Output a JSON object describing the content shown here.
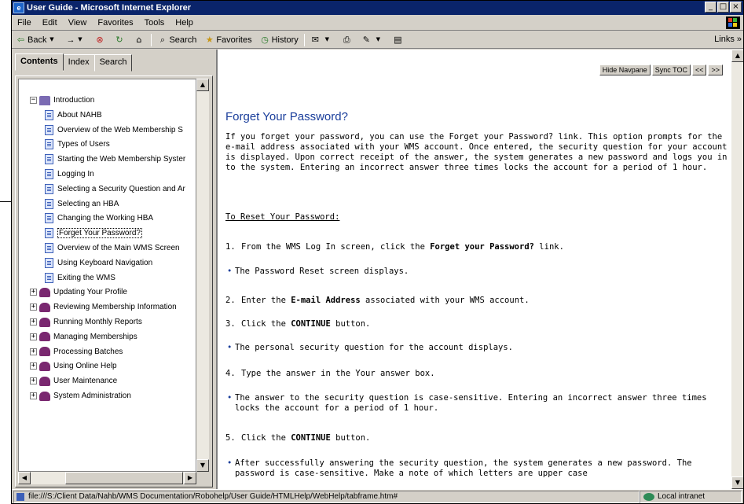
{
  "window": {
    "title": "User Guide - Microsoft Internet Explorer"
  },
  "menubar": {
    "items": [
      "File",
      "Edit",
      "View",
      "Favorites",
      "Tools",
      "Help"
    ]
  },
  "toolbar": {
    "back": "Back",
    "forward_arrow": "→",
    "search": "Search",
    "favorites": "Favorites",
    "history": "History",
    "links": "Links »"
  },
  "leftpane": {
    "tabs": [
      "Contents",
      "Index",
      "Search"
    ],
    "tree": [
      {
        "label": "Introduction",
        "type": "book-open",
        "expander": "−"
      },
      {
        "label": "About NAHB",
        "type": "page"
      },
      {
        "label": "Overview of the Web Membership S",
        "type": "page"
      },
      {
        "label": "Types of Users",
        "type": "page"
      },
      {
        "label": "Starting the Web Membership Syster",
        "type": "page"
      },
      {
        "label": "Logging In",
        "type": "page"
      },
      {
        "label": "Selecting a Security Question and Ar",
        "type": "page"
      },
      {
        "label": "Selecting an HBA",
        "type": "page"
      },
      {
        "label": "Changing the Working HBA",
        "type": "page"
      },
      {
        "label": "Forget Your Password?",
        "type": "page",
        "selected": true
      },
      {
        "label": "Overview of the Main WMS Screen",
        "type": "page"
      },
      {
        "label": "Using Keyboard Navigation",
        "type": "page"
      },
      {
        "label": "Exiting the WMS",
        "type": "page"
      },
      {
        "label": "Updating Your Profile",
        "type": "book",
        "expander": "+"
      },
      {
        "label": "Reviewing Membership Information",
        "type": "book",
        "expander": "+"
      },
      {
        "label": "Running Monthly Reports",
        "type": "book",
        "expander": "+"
      },
      {
        "label": "Managing Memberships",
        "type": "book",
        "expander": "+"
      },
      {
        "label": "Processing Batches",
        "type": "book",
        "expander": "+"
      },
      {
        "label": "Using Online Help",
        "type": "book",
        "expander": "+"
      },
      {
        "label": "User Maintenance",
        "type": "book",
        "expander": "+"
      },
      {
        "label": "System Administration",
        "type": "book",
        "expander": "+"
      }
    ]
  },
  "content": {
    "nav_buttons": [
      "Hide Navpane",
      "Sync TOC",
      "<<",
      ">>"
    ],
    "title": "Forget Your Password?",
    "intro": "If you forget your password, you can use the Forget your Password? link. This option prompts for the e-mail address associated with your WMS account. Once entered, the security question for your account is displayed. Upon correct receipt of the answer, the system generates a new password and logs you in to the system. Entering an incorrect answer three times locks the account for a period of 1 hour.",
    "reset_heading": "To Reset Your Password:",
    "step1": {
      "num": "1.",
      "pre": "From the WMS Log In screen, click the ",
      "bold": "Forget your Password?",
      "post": " link."
    },
    "bullet1": "The Password Reset screen displays.",
    "step2": {
      "num": "2.",
      "pre": "Enter the ",
      "bold": "E-mail Address",
      "post": " associated with your WMS account."
    },
    "step3": {
      "num": "3.",
      "pre": "Click the ",
      "bold": "CONTINUE",
      "post": " button."
    },
    "bullet2": "The personal security question for the account displays.",
    "step4": {
      "num": "4.",
      "text": "Type the answer in the Your answer box."
    },
    "bullet3": "The answer to the security question is case-sensitive. Entering an incorrect answer three times locks the account for a period of 1 hour.",
    "step5": {
      "num": "5.",
      "pre": "Click the ",
      "bold": "CONTINUE",
      "post": " button."
    },
    "bullet4": "After successfully answering the security question, the system generates a new password. The password is case-sensitive. Make a note of which letters are upper case"
  },
  "status": {
    "url": "file:///S:/Client Data/Nahb/WMS Documentation/Robohelp/User Guide/HTMLHelp/WebHelp/tabframe.htm#",
    "zone": "Local intranet"
  }
}
